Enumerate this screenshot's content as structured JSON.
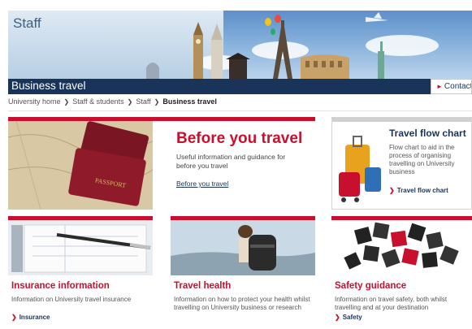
{
  "banner": {
    "section_title": "Staff",
    "page_title": "Business travel",
    "contact_label": "Contact"
  },
  "breadcrumb": {
    "items": [
      "University home",
      "Staff & students",
      "Staff"
    ],
    "current": "Business travel"
  },
  "feature": {
    "heading": "Before you travel",
    "description": "Useful information and guidance for before you travel",
    "link": "Before you travel"
  },
  "flowchart": {
    "heading": "Travel flow chart",
    "description": "Flow chart to aid in the process of organising travelling on University business",
    "link": "Travel flow chart"
  },
  "tiles": [
    {
      "heading": "Insurance information",
      "description": "Information on University travel insurance",
      "link": "Insurance"
    },
    {
      "heading": "Travel health",
      "description": "Information on how to protect your health whilst travelling on University business or research",
      "link": ""
    },
    {
      "heading": "Safety guidance",
      "description": "Information on travel safety, both whilst travelling and at your destination",
      "link": "Safety"
    }
  ],
  "colors": {
    "accent_red": "#c8102e",
    "navy": "#1a3358"
  },
  "icons": {
    "chevron": "chevron-right-icon"
  }
}
